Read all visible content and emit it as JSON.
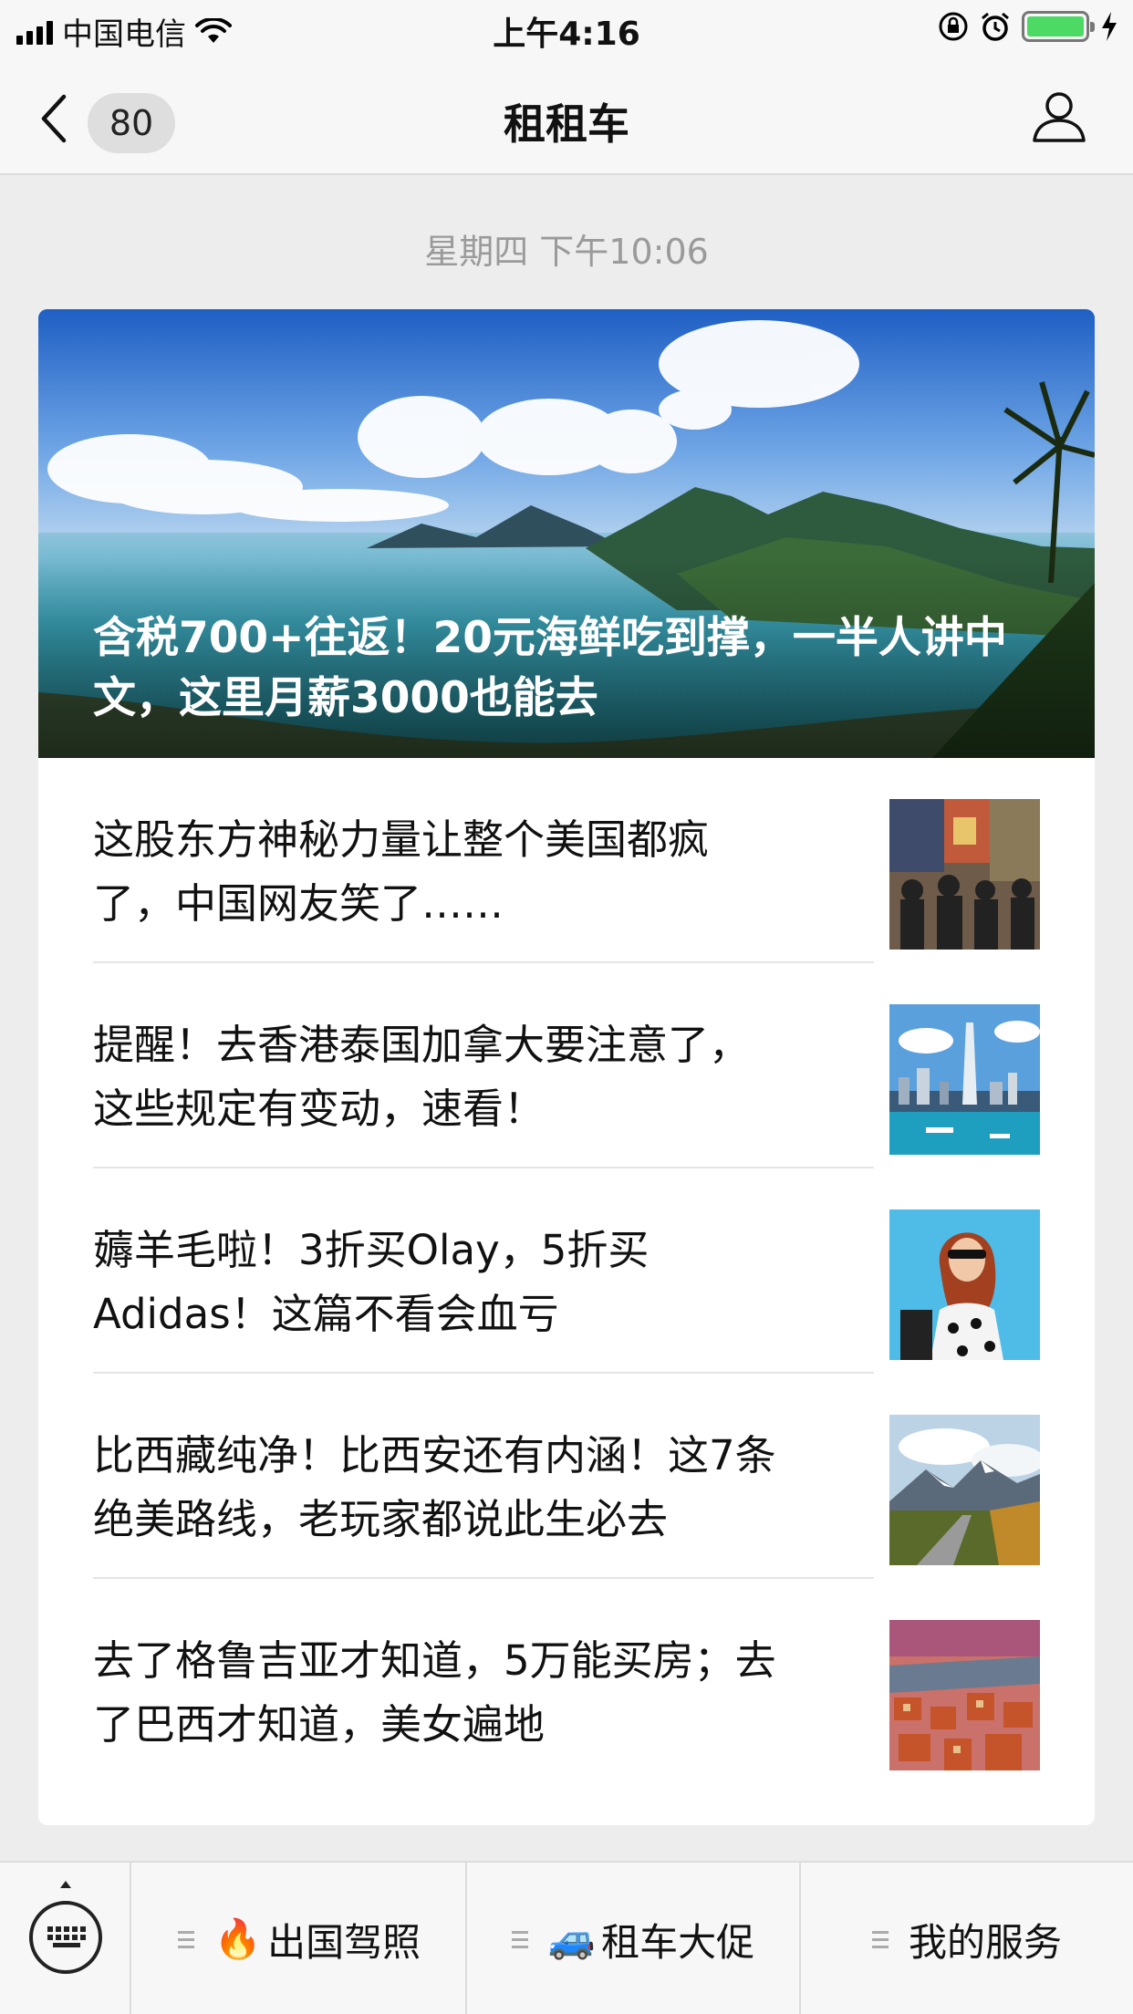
{
  "status_bar": {
    "carrier": "中国电信",
    "time": "上午4:16"
  },
  "nav": {
    "unread_count": "80",
    "title": "租租车"
  },
  "timestamp": "星期四 下午10:06",
  "hero": {
    "title": "含税700+往返！20元海鲜吃到撑，一半人讲中文，这里月薪3000也能去"
  },
  "articles": [
    {
      "title": "这股东方神秘力量让整个美国都疯了，中国网友笑了……"
    },
    {
      "title": "提醒！去香港泰国加拿大要注意了，这些规定有变动，速看！"
    },
    {
      "title": "薅羊毛啦！3折买Olay，5折买Adidas！这篇不看会血亏"
    },
    {
      "title": "比西藏纯净！比西安还有内涵！这7条绝美路线，老玩家都说此生必去"
    },
    {
      "title": "去了格鲁吉亚才知道，5万能买房；去了巴西才知道，美女遍地"
    }
  ],
  "menu": [
    {
      "emoji": "🔥",
      "label": "出国驾照"
    },
    {
      "emoji": "🚙",
      "label": "租车大促"
    },
    {
      "emoji": "",
      "label": "我的服务"
    }
  ]
}
